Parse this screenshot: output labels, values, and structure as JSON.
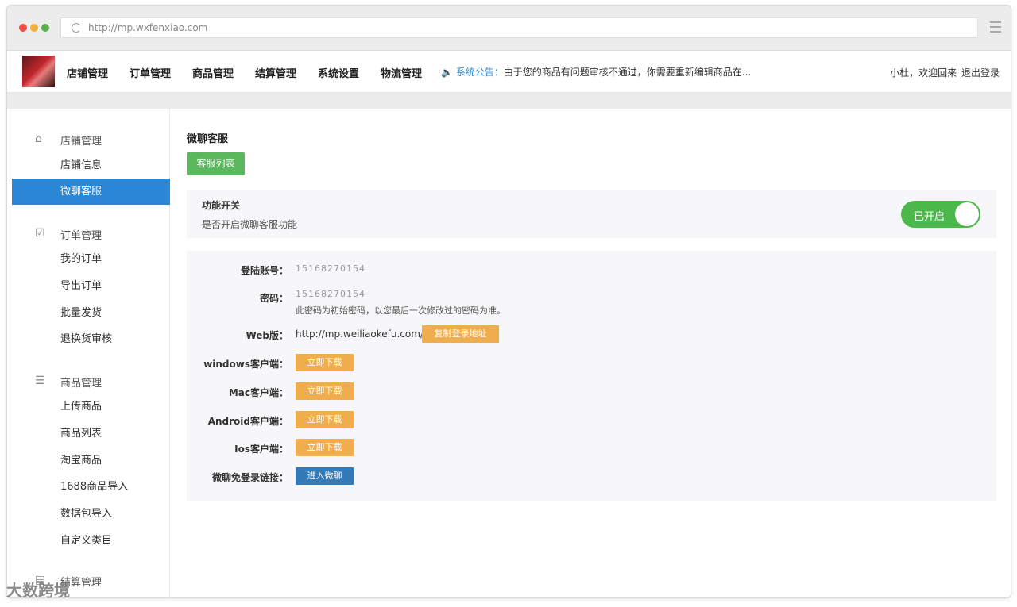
{
  "browser": {
    "url": "http://mp.wxfenxiao.com"
  },
  "topnav": {
    "items": [
      "店铺管理",
      "订单管理",
      "商品管理",
      "结算管理",
      "系统设置",
      "物流管理"
    ],
    "notice_label": "系统公告：",
    "notice_text": "由于您的商品有问题审核不通过，你需要重新编辑商品在...",
    "greeting": "小杜，欢迎回来",
    "logout": "退出登录"
  },
  "sidebar": {
    "groups": [
      {
        "title": "店铺管理",
        "icon": "home-icon",
        "items": [
          "店铺信息",
          "微聊客服"
        ]
      },
      {
        "title": "订单管理",
        "icon": "clipboard-check-icon",
        "items": [
          "我的订单",
          "导出订单",
          "批量发货",
          "退换货审核"
        ]
      },
      {
        "title": "商品管理",
        "icon": "database-icon",
        "items": [
          "上传商品",
          "商品列表",
          "淘宝商品",
          "1688商品导入",
          "数据包导入",
          "自定义类目"
        ]
      },
      {
        "title": "结算管理",
        "icon": "wallet-icon",
        "items": []
      }
    ],
    "active_item": "微聊客服"
  },
  "content": {
    "page_title": "微聊客服",
    "list_button": "客服列表",
    "switch": {
      "title": "功能开关",
      "desc": "是否开启微聊客服功能",
      "state_label": "已开启",
      "on": true
    },
    "info": {
      "account_label": "登陆账号：",
      "account_value": "15168270154",
      "password_label": "密码：",
      "password_value": "15168270154",
      "password_note": "此密码为初始密码，以您最后一次修改过的密码为准。",
      "web_label": "Web版：",
      "web_url": "http://mp.weiliaokefu.com/",
      "copy_button": "复制登录地址",
      "windows_label": "windows客户端：",
      "mac_label": "Mac客户端：",
      "android_label": "Android客户端：",
      "ios_label": "Ios客户端：",
      "download_button": "立即下载",
      "nologin_label": "微聊免登录链接：",
      "enter_button": "进入微聊"
    }
  },
  "watermark": "大数跨境",
  "colors": {
    "accent_blue": "#2987d6",
    "green": "#5cb85c",
    "toggle_green": "#4cb84c",
    "orange": "#f0ad4e",
    "blue_button": "#337ab7"
  }
}
